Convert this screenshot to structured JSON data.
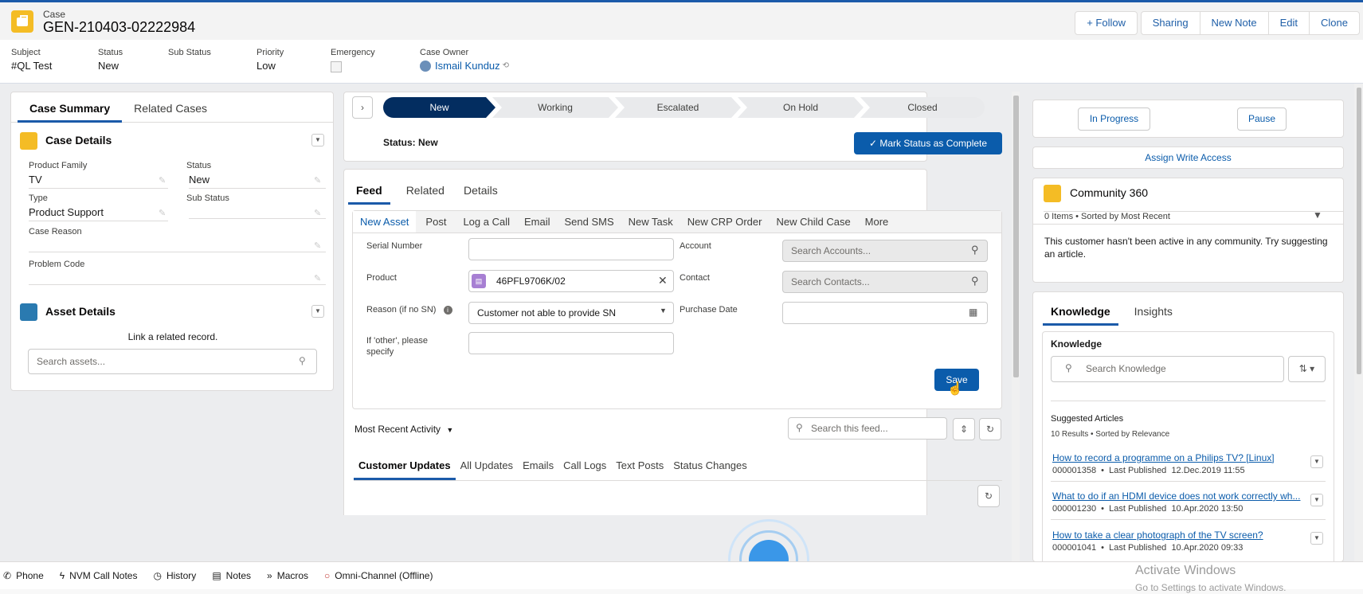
{
  "header": {
    "object_label": "Case",
    "record_title": "GEN-210403-02222984",
    "actions": {
      "follow": "+ Follow",
      "sharing": "Sharing",
      "new_note": "New Note",
      "edit": "Edit",
      "clone": "Clone"
    },
    "fields": [
      {
        "label": "Subject",
        "value": "#QL Test"
      },
      {
        "label": "Status",
        "value": "New"
      },
      {
        "label": "Sub Status",
        "value": ""
      },
      {
        "label": "Priority",
        "value": "Low"
      },
      {
        "label": "Emergency",
        "value": ""
      },
      {
        "label": "Case Owner",
        "value": "Ismail Kunduz"
      }
    ]
  },
  "left": {
    "tabs": [
      "Case Summary",
      "Related Cases"
    ],
    "case_details": {
      "title": "Case Details",
      "fields": [
        {
          "label": "Product Family",
          "value": "TV"
        },
        {
          "label": "Status",
          "value": "New"
        },
        {
          "label": "Type",
          "value": "Product Support"
        },
        {
          "label": "Sub Status",
          "value": ""
        },
        {
          "label": "Case Reason",
          "value": ""
        },
        {
          "label": "Problem Code",
          "value": ""
        }
      ]
    },
    "asset_details": {
      "title": "Asset Details",
      "hint": "Link a related record.",
      "search_placeholder": "Search assets..."
    }
  },
  "center": {
    "path": [
      "New",
      "Working",
      "Escalated",
      "On Hold",
      "Closed"
    ],
    "status_text": "Status: New",
    "mark_complete": "Mark Status as Complete",
    "feed_tabs": [
      "Feed",
      "Related",
      "Details"
    ],
    "quick_actions": [
      "New Asset",
      "Post",
      "Log a Call",
      "Email",
      "Send SMS",
      "New Task",
      "New CRP Order",
      "New Child Case",
      "More"
    ],
    "form": {
      "serial_number_label": "Serial Number",
      "product_label": "Product",
      "product_value": "46PFL9706K/02",
      "reason_label": "Reason (if no SN)",
      "reason_value": "Customer not able to provide SN",
      "other_label": "If 'other', please specify",
      "account_label": "Account",
      "account_placeholder": "Search Accounts...",
      "contact_label": "Contact",
      "contact_placeholder": "Search Contacts...",
      "purchase_date_label": "Purchase Date",
      "save": "Save"
    },
    "activity_filter": "Most Recent Activity",
    "feed_search_placeholder": "Search this feed...",
    "update_tabs": [
      "Customer Updates",
      "All Updates",
      "Emails",
      "Call Logs",
      "Text Posts",
      "Status Changes"
    ]
  },
  "right": {
    "in_progress": "In Progress",
    "pause": "Pause",
    "assign_write_access": "Assign Write Access",
    "community": {
      "title": "Community 360",
      "meta": "0 Items • Sorted by Most Recent",
      "message": "This customer hasn't been active in any community. Try suggesting an article."
    },
    "knowledge_tabs": [
      "Knowledge",
      "Insights"
    ],
    "knowledge": {
      "title": "Knowledge",
      "search_placeholder": "Search Knowledge",
      "suggested_title": "Suggested Articles",
      "suggested_meta": "10 Results • Sorted by Relevance",
      "articles": [
        {
          "title": "How to record a programme on a Philips TV? [Linux]",
          "number": "000001358",
          "published_label": "Last Published",
          "date": "12.Dec.2019 11:55"
        },
        {
          "title": "What to do if an HDMI device does not work correctly wh...",
          "number": "000001230",
          "published_label": "Last Published",
          "date": "10.Apr.2020 13:50"
        },
        {
          "title": "How to take a clear photograph of the TV screen?",
          "number": "000001041",
          "published_label": "Last Published",
          "date": "10.Apr.2020 09:33"
        }
      ]
    }
  },
  "utility_bar": [
    "Phone",
    "NVM Call Notes",
    "History",
    "Notes",
    "Macros",
    "Omni-Channel (Offline)"
  ],
  "watermark": {
    "title": "Activate Windows",
    "subtitle": "Go to Settings to activate Windows."
  }
}
